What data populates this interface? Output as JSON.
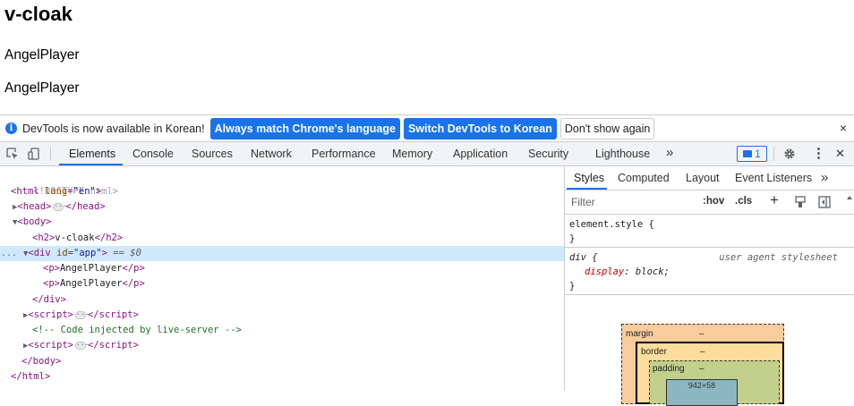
{
  "page": {
    "heading": "v-cloak",
    "paragraphs": [
      "AngelPlayer",
      "AngelPlayer"
    ]
  },
  "infobar": {
    "message": "DevTools is now available in Korean!",
    "btn_match": "Always match Chrome's language",
    "btn_switch": "Switch DevTools to Korean",
    "btn_dismiss": "Don't show again",
    "close": "×"
  },
  "toolbar": {
    "tabs": [
      "Elements",
      "Console",
      "Sources",
      "Network",
      "Performance",
      "Memory",
      "Application",
      "Security",
      "Lighthouse"
    ],
    "more": "»",
    "issues_count": "1",
    "menu": "⋮",
    "close": "✕"
  },
  "dom": {
    "doctype": "<!DOCTYPE html>",
    "html_tag": "html",
    "html_attr": "lang",
    "html_attr_val": "\"en\"",
    "head": "head",
    "body": "body",
    "h2_text": "v-cloak",
    "div_attr": "id",
    "div_attr_val": "\"app\"",
    "div_suffix": "== $0",
    "p1_text": "AngelPlayer",
    "p2_text": "AngelPlayer",
    "comment": "<!-- Code injected by live-server -->",
    "dots": "..."
  },
  "styles_pane": {
    "tabs": [
      "Styles",
      "Computed",
      "Layout",
      "Event Listeners"
    ],
    "more": "»",
    "filter_placeholder": "Filter",
    "hov": ":hov",
    "cls": ".cls",
    "plus": "+",
    "element_style": "element.style {",
    "close_brace": "}",
    "div_rule": "div {",
    "ua_label": "user agent stylesheet",
    "prop_name": "display",
    "prop_value": "block;",
    "box_model": {
      "margin_label": "margin",
      "margin_value": "–",
      "border_label": "border",
      "border_value": "–",
      "padding_label": "padding",
      "padding_value": "–",
      "content_value": "942×58"
    }
  }
}
